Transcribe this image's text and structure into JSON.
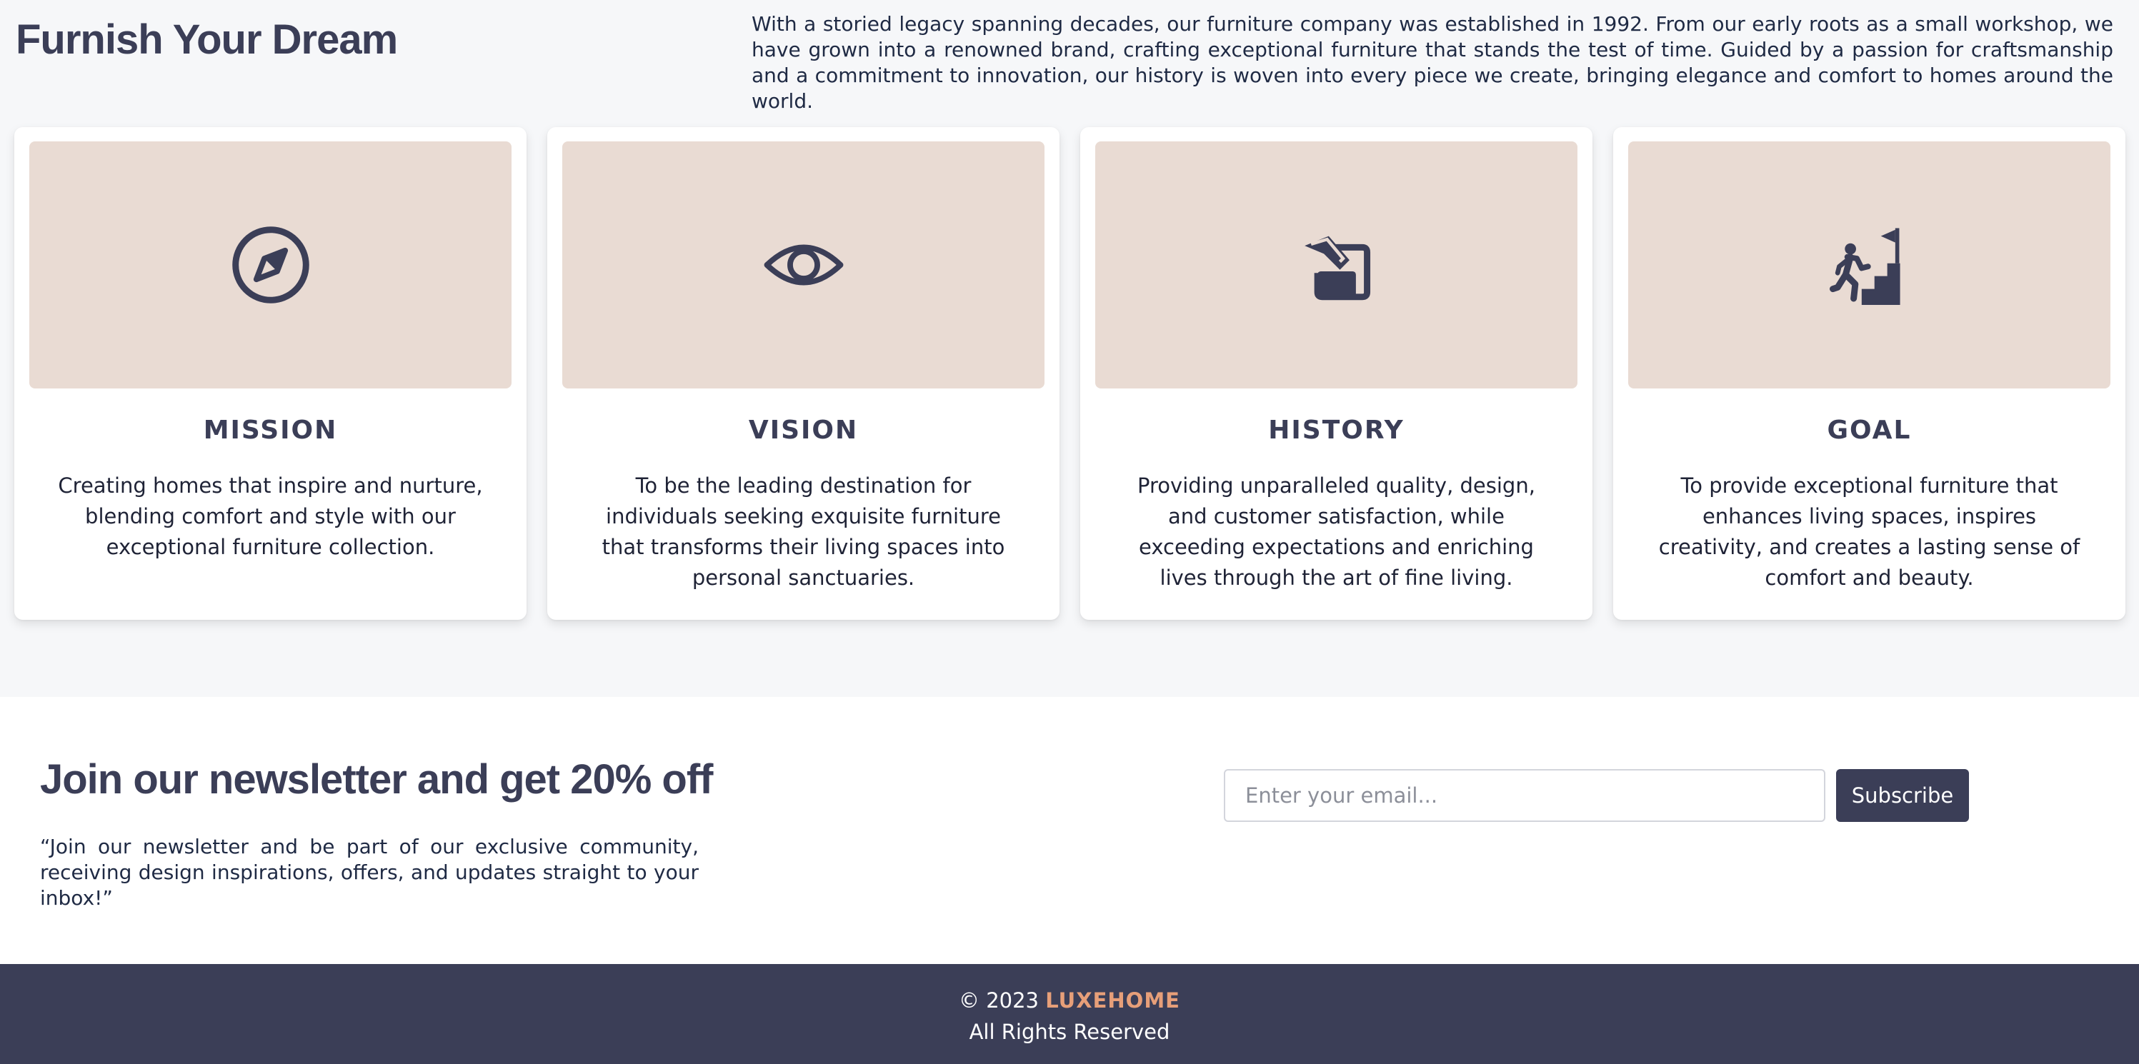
{
  "about": {
    "title": "Furnish Your Dream",
    "description": "With a storied legacy spanning decades, our furniture company was established in 1992. From our early roots as a small workshop, we have grown into a renowned brand, crafting exceptional furniture that stands the test of time. Guided by a passion for craftsmanship and a commitment to innovation, our history is woven into every piece we create, bringing elegance and comfort to homes around the world."
  },
  "cards": [
    {
      "icon": "compass-icon",
      "title": "MISSION",
      "text": "Creating homes that inspire and nurture, blending comfort and style with our exceptional furniture collection."
    },
    {
      "icon": "eye-icon",
      "title": "VISION",
      "text": "To be the leading destination for individuals seeking exquisite furniture that transforms their living spaces into personal sanctuaries."
    },
    {
      "icon": "history-icon",
      "title": "HISTORY",
      "text": "Providing unparalleled quality, design, and customer satisfaction, while exceeding expectations and enriching lives through the art of fine living."
    },
    {
      "icon": "goal-stairs-icon",
      "title": "GOAL",
      "text": "To provide exceptional furniture that enhances living spaces, inspires creativity, and creates a lasting sense of comfort and beauty."
    }
  ],
  "newsletter": {
    "title": "Join our newsletter and get 20% off",
    "text": "“Join our newsletter and be part of our exclusive community, receiving design inspirations, offers, and updates straight to your inbox!”",
    "email_placeholder": "Enter your email...",
    "email_value": "",
    "subscribe_label": "Subscribe"
  },
  "footer": {
    "copyright_prefix": "© 2023",
    "brand": "LUXEHOME",
    "rights": "All Rights Reserved"
  },
  "colors": {
    "accent": "#3b3e57",
    "brand": "#e79f79",
    "card_image_bg": "#e9dbd3",
    "page_bg": "#f6f7f9"
  }
}
